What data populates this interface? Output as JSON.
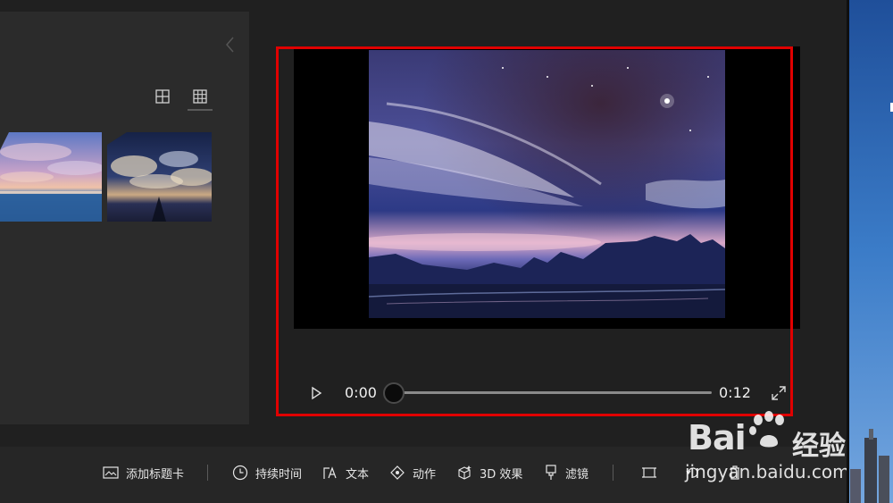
{
  "library": {
    "view_toggles": [
      "grid-large-icon",
      "grid-small-icon"
    ],
    "thumbnails": [
      {
        "name": "sunset-sky-thumbnail",
        "colors": [
          "#6f86c8",
          "#c7a2c7",
          "#3c6fb0"
        ]
      },
      {
        "name": "night-clouds-thumbnail",
        "colors": [
          "#1e2a55",
          "#bfa27a",
          "#24315a"
        ]
      }
    ]
  },
  "preview": {
    "highlight_color": "#e00000",
    "image_name": "starry-night-landscape"
  },
  "player": {
    "current_time": "0:00",
    "total_time": "0:12",
    "progress": 0.0
  },
  "toolbar": {
    "add_title_card": "添加标题卡",
    "duration": "持续时间",
    "text": "文本",
    "motion": "动作",
    "effects_3d": "3D 效果",
    "filters": "滤镜"
  },
  "watermark": {
    "logo": "Bai",
    "logo_suffix": "经验",
    "url": "jingyan.baidu.com"
  }
}
